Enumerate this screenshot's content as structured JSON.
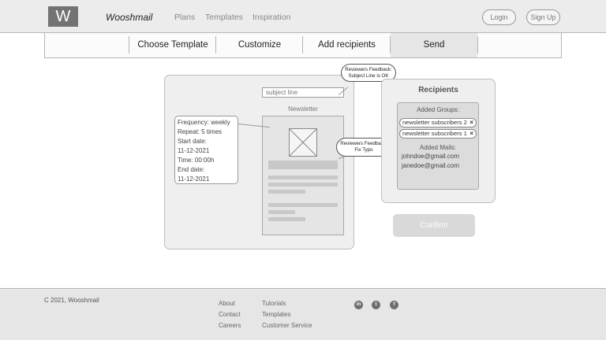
{
  "header": {
    "logo": "W",
    "brand": "Wooshmail",
    "nav": [
      "Plans",
      "Templates",
      "Inspiration"
    ],
    "login": "Login",
    "signup": "Sign Up"
  },
  "steps": [
    "Choose Template",
    "Customize",
    "Add recipients",
    "Send"
  ],
  "active_step": "Send",
  "editor": {
    "subject_placeholder": "subject line",
    "newsletter_title": "Newsletter",
    "schedule": [
      "Frequency: weekly",
      "Repeat: 5 times",
      "Start date:",
      "11-12-2021",
      "Time: 00:00h",
      "End date:",
      "11-12-2021"
    ]
  },
  "feedback": [
    {
      "line1": "Reviewers Feedback:",
      "line2": "Subject Line is OK"
    },
    {
      "line1": "Reviewers Feedback:",
      "line2": "Fix Typo"
    }
  ],
  "recipients": {
    "title": "Recipients",
    "groups_label": "Added Groups:",
    "groups": [
      "newsletter subscribers 2",
      "newsletter subscribers 1"
    ],
    "remove_glyph": "×",
    "mails_label": "Added Mails:",
    "mails": [
      "johndoe@gmail.com",
      "janedoe@gmail.com"
    ]
  },
  "confirm": "Confirm",
  "footer": {
    "copyright": "C 2021, Wooshmail",
    "col1": [
      "About",
      "Contact",
      "Careers"
    ],
    "col2": [
      "Tutorials",
      "Templates",
      "Customer Service"
    ],
    "social": [
      {
        "icon": "linkedin-icon",
        "glyph": "in"
      },
      {
        "icon": "twitter-icon",
        "glyph": "t"
      },
      {
        "icon": "facebook-icon",
        "glyph": "f"
      }
    ]
  }
}
